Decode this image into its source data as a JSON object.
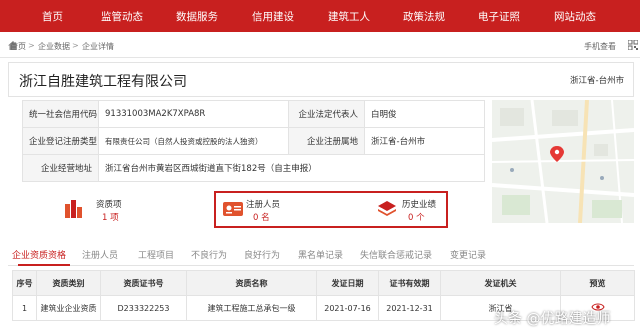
{
  "nav": {
    "items": [
      "首页",
      "监管动态",
      "数据服务",
      "信用建设",
      "建筑工人",
      "政策法规",
      "电子证照",
      "网站动态"
    ]
  },
  "breadcrumb": {
    "items": [
      "首页",
      "企业数据",
      "企业详情"
    ],
    "separator": ">",
    "mobile_view": "手机查看"
  },
  "company": {
    "name": "浙江自胜建筑工程有限公司",
    "location": "浙江省-台州市"
  },
  "info": {
    "credit_code_label": "统一社会信用代码",
    "credit_code": "91331003MA2K7XPA8R",
    "legal_rep_label": "企业法定代表人",
    "legal_rep": "白明俊",
    "reg_type_label": "企业登记注册类型",
    "reg_type": "有限责任公司（自然人投资或控股的法人独资）",
    "reg_place_label": "企业注册属地",
    "reg_place": "浙江省-台州市",
    "address_label": "企业经营地址",
    "address": "浙江省台州市黄岩区西城街道直下街182号（自主申报）"
  },
  "stats": [
    {
      "label": "资质项",
      "value": "1 项",
      "icon": "building-icon"
    },
    {
      "label": "注册人员",
      "value": "0 名",
      "icon": "id-card-icon"
    },
    {
      "label": "历史业绩",
      "value": "0 个",
      "icon": "layers-icon"
    }
  ],
  "tabs": [
    "企业资质资格",
    "注册人员",
    "工程项目",
    "不良行为",
    "良好行为",
    "黑名单记录",
    "失信联合惩戒记录",
    "变更记录"
  ],
  "table": {
    "headers": [
      "序号",
      "资质类别",
      "资质证书号",
      "资质名称",
      "发证日期",
      "证书有效期",
      "发证机关",
      "预览"
    ],
    "rows": [
      [
        "1",
        "建筑业企业资质",
        "D233322253",
        "建筑工程施工总承包一级",
        "2021-07-16",
        "2021-12-31",
        "浙江省",
        ""
      ]
    ]
  },
  "watermark": "头条 @优路建造师",
  "colors": {
    "brand_red": "#c8201f",
    "label_bg": "#f5f5f5",
    "border": "#e3e3e3"
  }
}
